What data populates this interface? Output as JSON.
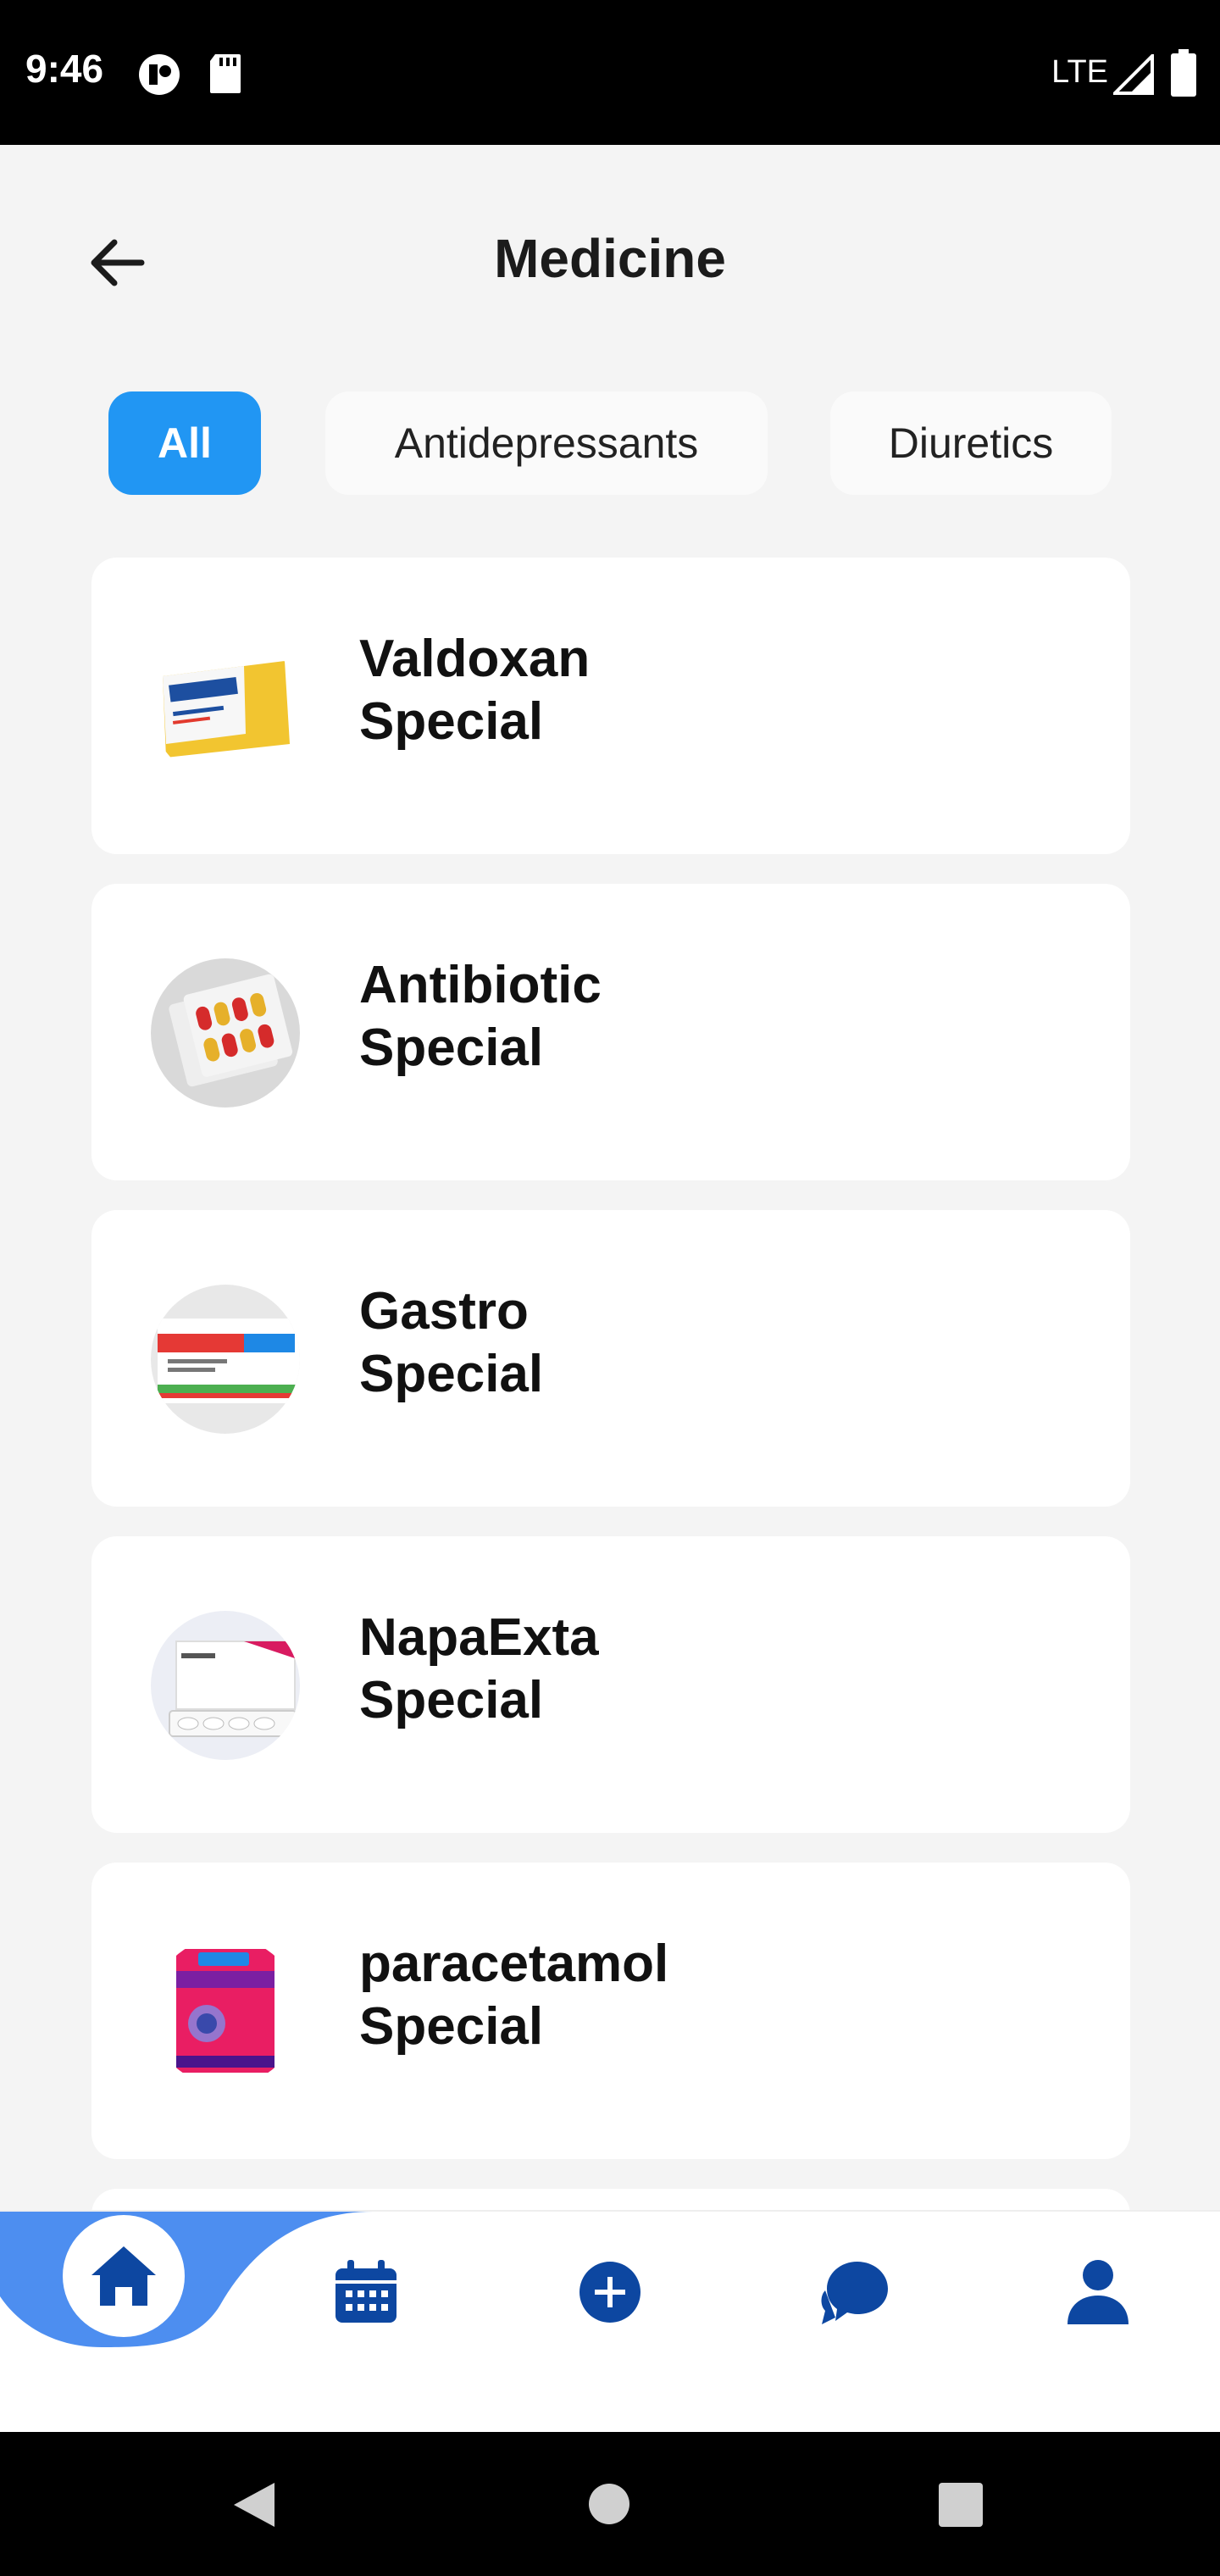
{
  "status_bar": {
    "time": "9:46",
    "network": "LTE",
    "icons": [
      "circle-app-icon",
      "sd-card-icon",
      "signal-icon",
      "battery-icon"
    ]
  },
  "header": {
    "title": "Medicine",
    "back_icon": "arrow-left-icon"
  },
  "filters": {
    "chips": [
      {
        "label": "All",
        "active": true
      },
      {
        "label": "Antidepressants",
        "active": false
      },
      {
        "label": "Diuretics",
        "active": false
      }
    ]
  },
  "medicines": [
    {
      "name": "Valdoxan",
      "subtitle": "Special",
      "image": "valdoxan-box"
    },
    {
      "name": "Antibiotic",
      "subtitle": "Special",
      "image": "antibiotic-blister"
    },
    {
      "name": "Gastro",
      "subtitle": "Special",
      "image": "gastro-stop-box"
    },
    {
      "name": "NapaExta",
      "subtitle": "Special",
      "image": "napa-extra-box"
    },
    {
      "name": "paracetamol",
      "subtitle": "Special",
      "image": "paracetamol-box"
    }
  ],
  "bottom_nav": {
    "items": [
      "home-icon",
      "calendar-icon",
      "add-icon",
      "chat-icon",
      "profile-icon"
    ],
    "active": "home-icon"
  },
  "colors": {
    "accent": "#2196f3",
    "nav_icon": "#0d47a1",
    "nav_wave": "#4d8ef0"
  }
}
